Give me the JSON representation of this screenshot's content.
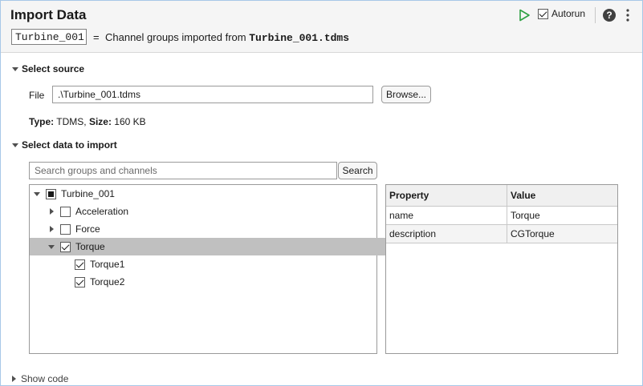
{
  "header": {
    "title": "Import Data",
    "variable_name": "Turbine_001",
    "equals": "=",
    "description_prefix": "Channel groups imported from",
    "description_file": "Turbine_001.tdms",
    "autorun_label": "Autorun",
    "autorun_checked": true,
    "help_glyph": "?"
  },
  "source": {
    "section_label": "Select source",
    "file_label": "File",
    "file_value": ".\\Turbine_001.tdms",
    "browse_label": "Browse...",
    "type_label": "Type:",
    "type_value": "TDMS,",
    "size_label": "Size:",
    "size_value": "160 KB"
  },
  "data": {
    "section_label": "Select data to import",
    "search_placeholder": "Search groups and channels",
    "search_button": "Search",
    "tree": [
      {
        "label": "Turbine_001",
        "state": "mixed",
        "expanded": true,
        "level": 0
      },
      {
        "label": "Acceleration",
        "state": "unchecked",
        "expanded": false,
        "level": 1
      },
      {
        "label": "Force",
        "state": "unchecked",
        "expanded": false,
        "level": 1
      },
      {
        "label": "Torque",
        "state": "checked",
        "expanded": true,
        "level": 1,
        "selected": true
      },
      {
        "label": "Torque1",
        "state": "checked",
        "level": 2
      },
      {
        "label": "Torque2",
        "state": "checked",
        "level": 2
      }
    ],
    "properties": {
      "headers": [
        "Property",
        "Value"
      ],
      "rows": [
        [
          "name",
          "Torque"
        ],
        [
          "description",
          "CGTorque"
        ]
      ]
    }
  },
  "footer": {
    "show_code_label": "Show code"
  },
  "icons": {
    "run": "play-icon",
    "help": "help-icon",
    "more": "more-vertical-icon"
  },
  "colors": {
    "run_icon": "#2ea043",
    "selected_row": "#c0c0c0",
    "header_bg": "#f5f5f5"
  }
}
